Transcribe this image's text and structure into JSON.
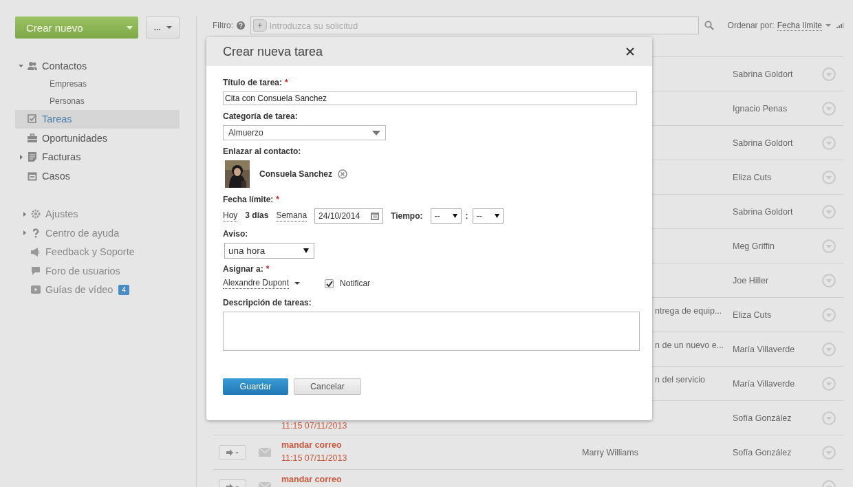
{
  "sidebar": {
    "create_button": "Crear nuevo",
    "more_button": "...",
    "nav": [
      {
        "label": "Contactos",
        "expanded": true,
        "selected": false,
        "children": [
          {
            "label": "Empresas",
            "selected": false
          },
          {
            "label": "Personas",
            "selected": false
          }
        ]
      },
      {
        "label": "Tareas",
        "selected": true
      },
      {
        "label": "Oportunidades",
        "selected": false
      },
      {
        "label": "Facturas",
        "expanded": false,
        "selected": false
      },
      {
        "label": "Casos",
        "selected": false
      }
    ],
    "help_nav": [
      {
        "label": "Ajustes",
        "expanded": false
      },
      {
        "label": "Centro de ayuda",
        "expanded": false
      },
      {
        "label": "Feedback y Soporte"
      },
      {
        "label": "Foro de usuarios"
      },
      {
        "label": "Guías de vídeo",
        "badge": "4"
      }
    ]
  },
  "filter": {
    "label": "Filtro:",
    "add": "+",
    "placeholder": "Introduzca su solicitud",
    "sort_label": "Ordenar por:",
    "sort_value": "Fecha límite"
  },
  "tasks": [
    {
      "owner": "Sabrina Goldort"
    },
    {
      "owner": "Ignacio Penas"
    },
    {
      "owner": "Sabrina Goldort"
    },
    {
      "owner": "Eliza Cuts"
    },
    {
      "owner": "Sabrina Goldort"
    },
    {
      "owner": "Meg Griffin"
    },
    {
      "owner": "Joe Hiller"
    },
    {
      "contact_fragment": "ntrega de equip...",
      "owner": "Eliza Cuts"
    },
    {
      "contact_fragment": "n de un nuevo e...",
      "owner": "María Villaverde"
    },
    {
      "contact_fragment": "n del servicio",
      "owner": "María Villaverde"
    },
    {
      "time": "11:15 07/11/2013",
      "owner": "Sofía González"
    },
    {
      "title": "mandar correo",
      "time": "11:15 07/11/2013",
      "contact": "Marry Williams",
      "owner": "Sofía González",
      "actions": true
    },
    {
      "title": "mandar correo",
      "actions": true
    }
  ],
  "dialog": {
    "title": "Crear nueva tarea",
    "task_title": {
      "label": "Título de tarea:",
      "required_mark": "*",
      "value": "Cita con Consuela Sanchez"
    },
    "category": {
      "label": "Categoría de tarea:",
      "value": "Almuerzo"
    },
    "contact": {
      "label": "Enlazar al contacto:",
      "name": "Consuela Sanchez"
    },
    "due": {
      "label": "Fecha límite:",
      "required_mark": "*",
      "shortcuts": [
        {
          "label": "Hoy",
          "selected": false
        },
        {
          "label": "3 días",
          "selected": true
        },
        {
          "label": "Semana",
          "selected": false
        }
      ],
      "date": "24/10/2014",
      "time_label": "Tiempo:",
      "hour": "--",
      "separator": ":",
      "minute": "--"
    },
    "reminder": {
      "label": "Aviso:",
      "value": "una hora"
    },
    "assign": {
      "label": "Asignar a:",
      "required_mark": "*",
      "value": "Alexandre Dupont",
      "notify": {
        "label": "Notificar",
        "checked": true
      }
    },
    "description": {
      "label": "Descripción de tareas:"
    },
    "buttons": {
      "save": "Guardar",
      "cancel": "Cancelar"
    }
  }
}
